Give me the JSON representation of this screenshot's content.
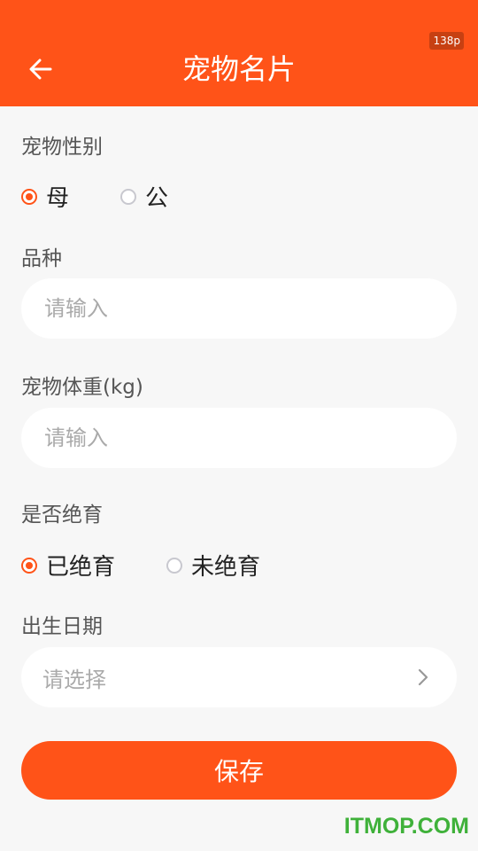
{
  "status_bar": {
    "resolution_badge": "138p"
  },
  "header": {
    "title": "宠物名片",
    "back_icon": "arrow-left-icon"
  },
  "form": {
    "gender": {
      "label": "宠物性别",
      "options": [
        "母",
        "公"
      ],
      "selected": "母"
    },
    "breed": {
      "label": "品种",
      "placeholder": "请输入",
      "value": ""
    },
    "weight": {
      "label": "宠物体重(kg)",
      "placeholder": "请输入",
      "value": ""
    },
    "neutered": {
      "label": "是否绝育",
      "options": [
        "已绝育",
        "未绝育"
      ],
      "selected": "已绝育"
    },
    "birthday": {
      "label": "出生日期",
      "placeholder": "请选择",
      "icon": "chevron-right-icon"
    }
  },
  "actions": {
    "save_label": "保存"
  },
  "watermark": "ITMOP.COM",
  "colors": {
    "accent": "#ff5318",
    "background": "#f7f7f7",
    "watermark": "#3fb13a"
  }
}
